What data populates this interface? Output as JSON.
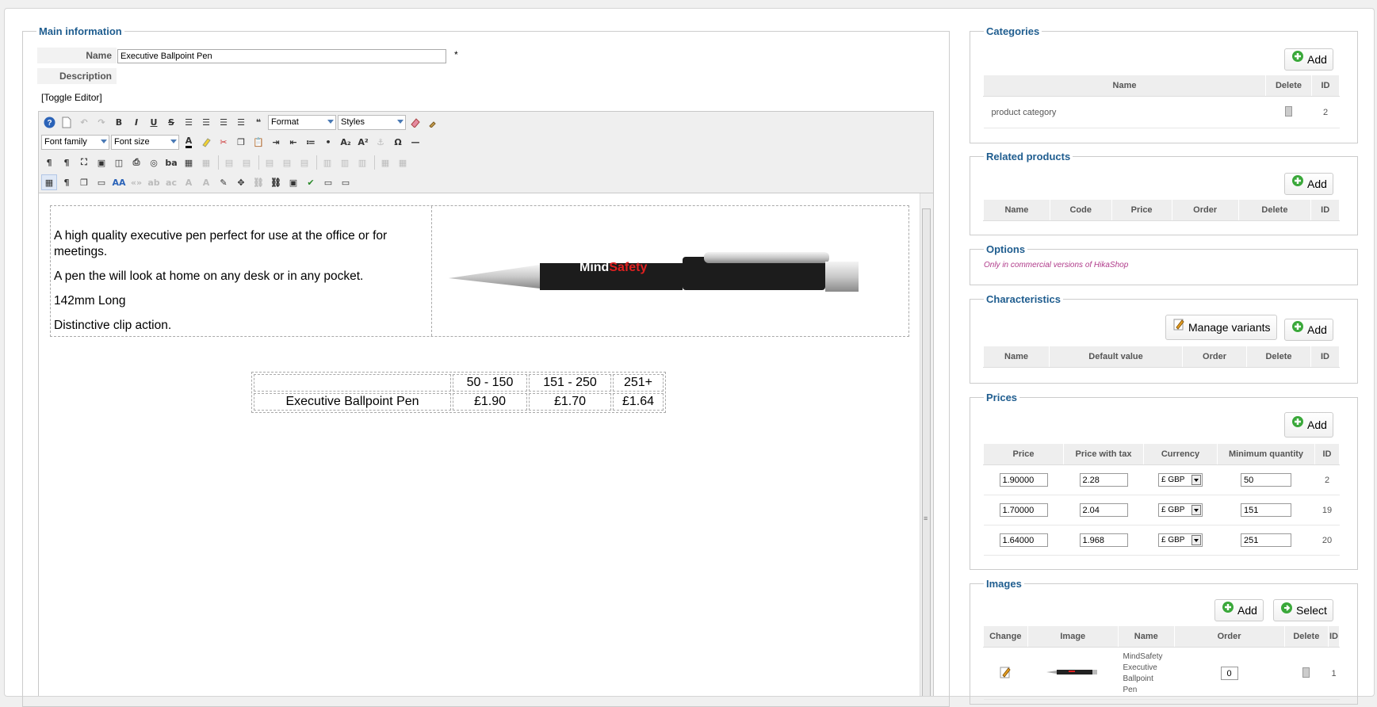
{
  "main": {
    "legend": "Main information",
    "name_label": "Name",
    "name_value": "Executive Ballpoint Pen",
    "required_mark": "*",
    "description_label": "Description",
    "toggle_editor": "[Toggle Editor]",
    "toolbar": {
      "format_label": "Format",
      "styles_label": "Styles",
      "font_family_label": "Font family",
      "font_size_label": "Font size"
    },
    "content": {
      "paragraphs": [
        "A high quality executive pen perfect for use at the office or for meetings.",
        "A pen the will look at home on any desk or in any pocket.",
        "142mm Long",
        "Distinctive clip action."
      ],
      "pen_brand": "MindSafety",
      "pen_brand_a": "Mind",
      "pen_brand_b": "Safety",
      "price_table": {
        "headers": [
          "",
          "50 - 150",
          "151 - 250",
          "251+"
        ],
        "row": [
          "Executive Ballpoint Pen",
          "£1.90",
          "£1.70",
          "£1.64"
        ]
      }
    }
  },
  "categories": {
    "legend": "Categories",
    "add_label": "Add",
    "columns": [
      "Name",
      "Delete",
      "ID"
    ],
    "rows": [
      {
        "name": "product category",
        "id": "2"
      }
    ]
  },
  "related_products": {
    "legend": "Related products",
    "add_label": "Add",
    "columns": [
      "Name",
      "Code",
      "Price",
      "Order",
      "Delete",
      "ID"
    ]
  },
  "options": {
    "legend": "Options",
    "note": "Only in commercial versions of HikaShop"
  },
  "characteristics": {
    "legend": "Characteristics",
    "manage_variants_label": "Manage variants",
    "add_label": "Add",
    "columns": [
      "Name",
      "Default value",
      "Order",
      "Delete",
      "ID"
    ]
  },
  "prices": {
    "legend": "Prices",
    "add_label": "Add",
    "columns": [
      "Price",
      "Price with tax",
      "Currency",
      "Minimum quantity",
      "ID"
    ],
    "rows": [
      {
        "price": "1.90000",
        "price_with_tax": "2.28",
        "currency": "£ GBP",
        "min_qty": "50",
        "id": "2"
      },
      {
        "price": "1.70000",
        "price_with_tax": "2.04",
        "currency": "£ GBP",
        "min_qty": "151",
        "id": "19"
      },
      {
        "price": "1.64000",
        "price_with_tax": "1.968",
        "currency": "£ GBP",
        "min_qty": "251",
        "id": "20"
      }
    ]
  },
  "images": {
    "legend": "Images",
    "add_label": "Add",
    "select_label": "Select",
    "columns": [
      "Change",
      "Image",
      "Name",
      "Order",
      "Delete",
      "ID"
    ],
    "rows": [
      {
        "name_lines": [
          "MindSafety",
          "Executive",
          "Ballpoint",
          "Pen"
        ],
        "order": "0",
        "id": "1"
      }
    ]
  },
  "colors": {
    "accent": "#1f5d8f",
    "note": "#b03a8a",
    "brand_red": "#e02020"
  }
}
